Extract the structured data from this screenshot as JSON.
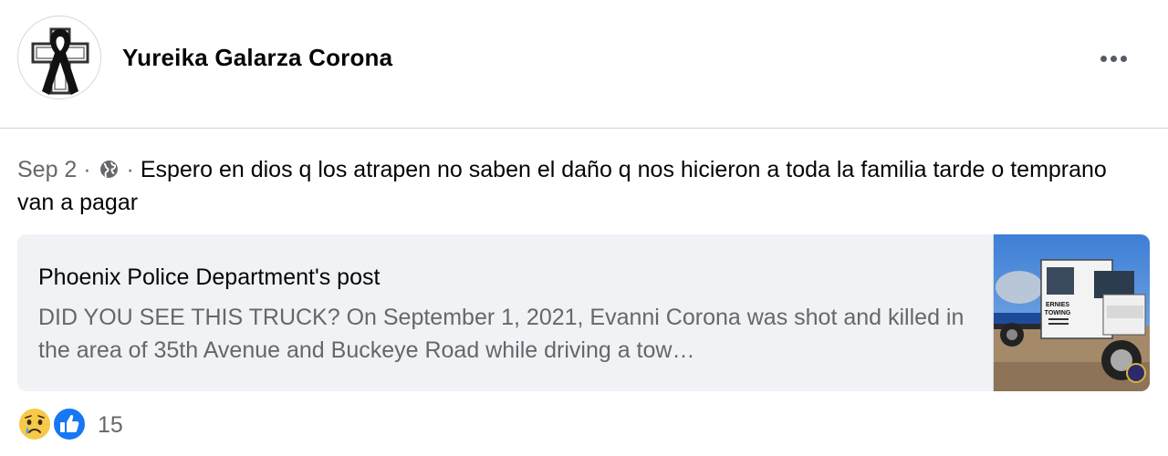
{
  "post": {
    "author": "Yureika Galarza Corona",
    "date": "Sep 2",
    "separator": "·",
    "privacy_icon": "globe-icon",
    "message": "Espero en dios q los atrapen no saben el daño q nos hicieron a toda la familia tarde o temprano van a pagar",
    "more_icon": "more-options-icon"
  },
  "shared": {
    "title": "Phoenix Police Department's post",
    "description": "DID YOU SEE THIS TRUCK? On September 1, 2021, Evanni Corona was shot and killed in the area of 35th Avenue and Buckeye Road while driving a tow…",
    "thumbnail_text": [
      "ERNIES",
      "TOWING"
    ]
  },
  "reactions": {
    "icons": [
      "sad-reaction-icon",
      "like-reaction-icon"
    ],
    "count": "15"
  },
  "colors": {
    "secondary_text": "#65676b",
    "card_bg": "#f0f2f5",
    "like_blue": "#1877f2",
    "sad_yellow": "#f7c94a"
  }
}
